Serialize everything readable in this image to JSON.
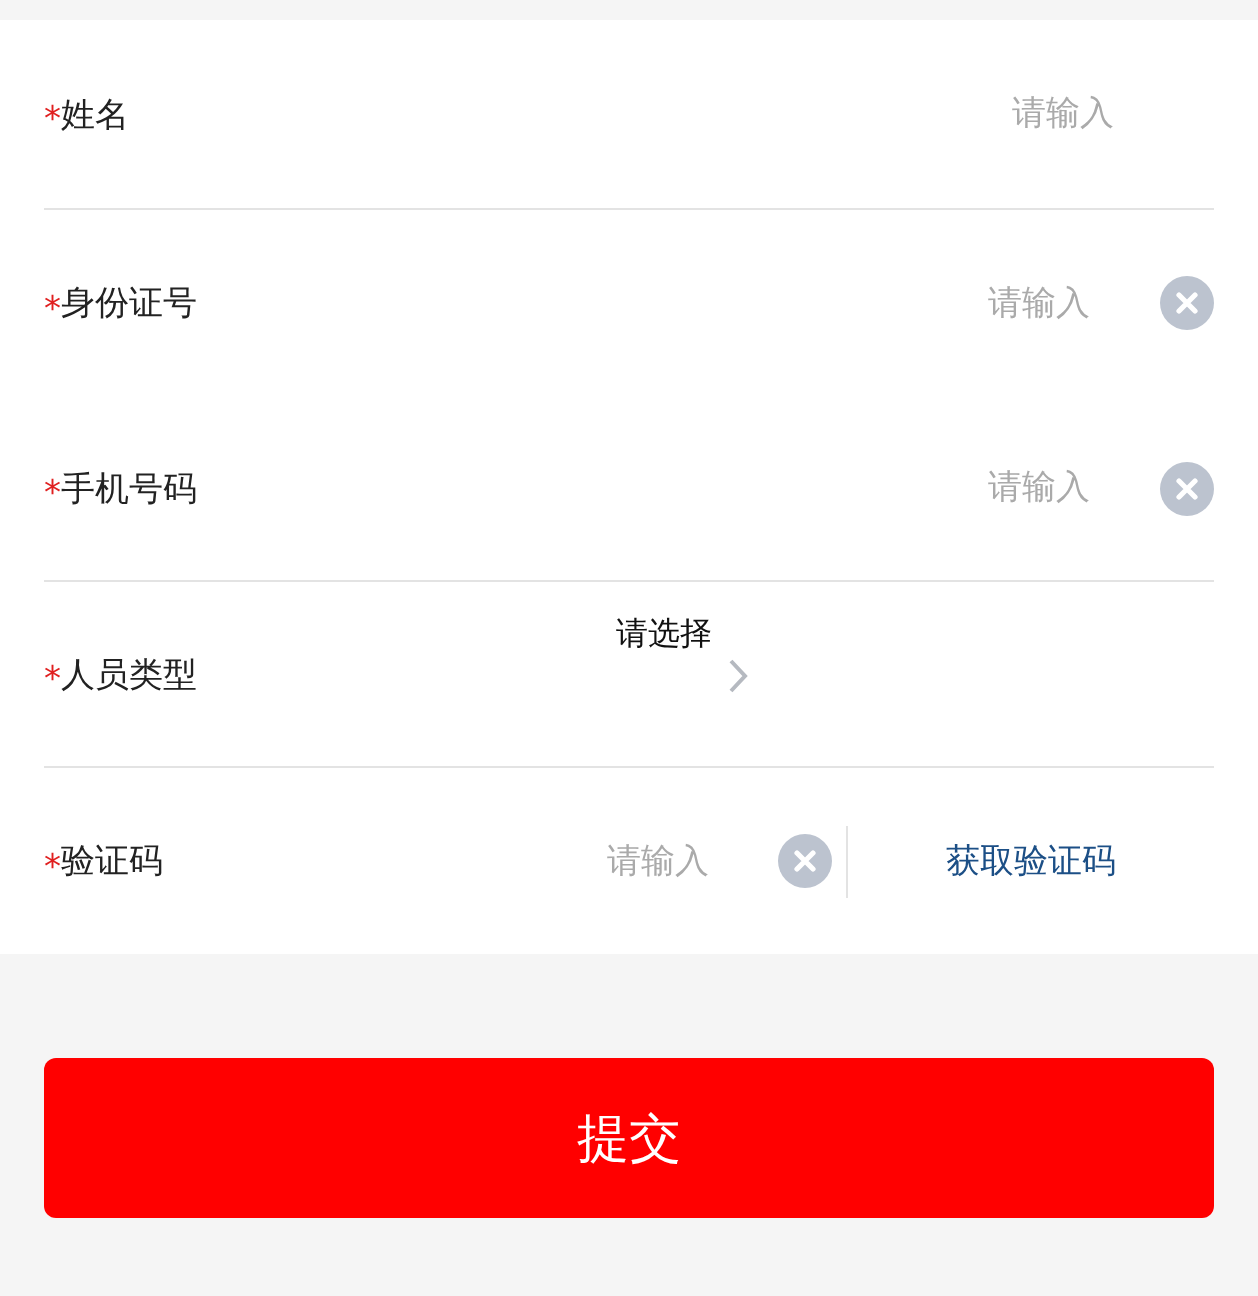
{
  "fields": [
    {
      "kind": "text",
      "required_mark": "*",
      "label": "姓名",
      "placeholder": "请输入",
      "clearable": false,
      "divider_below": true
    },
    {
      "kind": "text",
      "required_mark": "*",
      "label": "身份证号",
      "placeholder": "请输入",
      "clearable": true,
      "divider_below": false
    },
    {
      "kind": "text",
      "required_mark": "*",
      "label": "手机号码",
      "placeholder": "请输入",
      "clearable": true,
      "divider_below": true
    },
    {
      "kind": "select",
      "required_mark": "*",
      "label": "人员类型",
      "value": "请选择",
      "divider_below": true
    },
    {
      "kind": "code",
      "required_mark": "*",
      "label": "验证码",
      "placeholder": "请输入",
      "clearable": true,
      "action": "获取验证码",
      "divider_below": false
    }
  ],
  "submit_button": "提交"
}
